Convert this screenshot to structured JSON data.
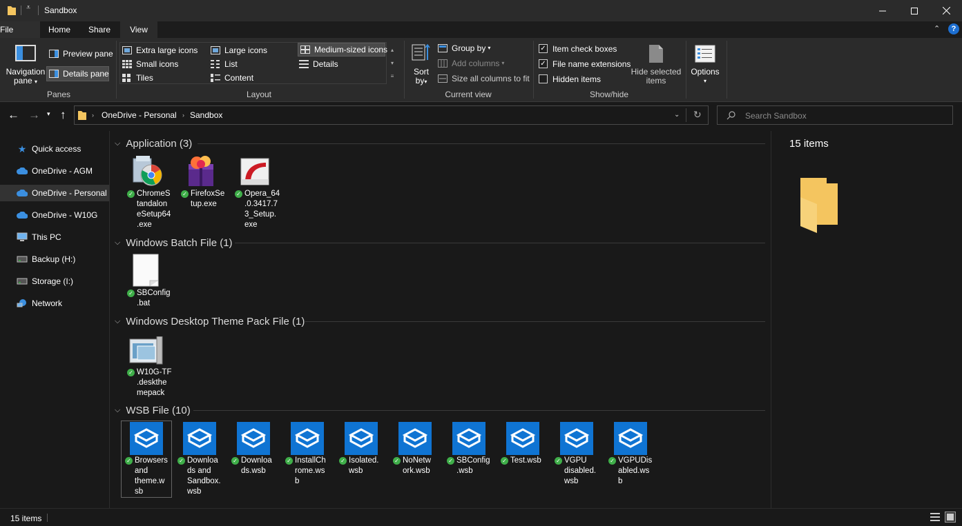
{
  "window": {
    "title": "Sandbox"
  },
  "tabs": [
    "File",
    "Home",
    "Share",
    "View"
  ],
  "ribbon": {
    "panes": {
      "navigation_pane_l1": "Navigation",
      "navigation_pane_l2": "pane",
      "preview_pane": "Preview pane",
      "details_pane": "Details pane",
      "group_label": "Panes"
    },
    "layout": {
      "items": [
        "Extra large icons",
        "Large icons",
        "Medium-sized icons",
        "Small icons",
        "List",
        "Details",
        "Tiles",
        "Content"
      ],
      "group_label": "Layout"
    },
    "current_view": {
      "sort_l1": "Sort",
      "sort_l2": "by",
      "group_by": "Group by",
      "add_columns": "Add columns",
      "size_all": "Size all columns to fit",
      "group_label": "Current view"
    },
    "show_hide": {
      "item_check_boxes": "Item check boxes",
      "file_name_extensions": "File name extensions",
      "hidden_items": "Hidden items",
      "hide_selected_l1": "Hide selected",
      "hide_selected_l2": "items",
      "group_label": "Show/hide"
    },
    "options": "Options"
  },
  "address": {
    "crumbs": [
      "OneDrive - Personal",
      "Sandbox"
    ],
    "search_placeholder": "Search Sandbox"
  },
  "sidebar": {
    "items": [
      {
        "label": "Quick access",
        "icon": "star-icon"
      },
      {
        "label": "OneDrive - AGM",
        "icon": "cloud-icon"
      },
      {
        "label": "OneDrive - Personal",
        "icon": "cloud-icon"
      },
      {
        "label": "OneDrive - W10G",
        "icon": "cloud-icon"
      },
      {
        "label": "This PC",
        "icon": "computer-icon"
      },
      {
        "label": "Backup (H:)",
        "icon": "drive-icon"
      },
      {
        "label": "Storage (I:)",
        "icon": "drive-icon"
      },
      {
        "label": "Network",
        "icon": "network-icon"
      }
    ]
  },
  "groups": [
    {
      "title": "Application (3)",
      "files": [
        {
          "name": "ChromeStandaloneSetup64.exe",
          "lines": [
            "ChromeS",
            "tandalon",
            "eSetup64",
            ".exe"
          ],
          "icon": "installer-icon"
        },
        {
          "name": "FirefoxSetup.exe",
          "lines": [
            "FirefoxSe",
            "tup.exe"
          ],
          "icon": "firefox-installer-icon"
        },
        {
          "name": "Opera_64.0.3417.73_Setup.exe",
          "lines": [
            "Opera_64",
            ".0.3417.7",
            "3_Setup.",
            "exe"
          ],
          "icon": "opera-installer-icon"
        }
      ]
    },
    {
      "title": "Windows Batch File (1)",
      "files": [
        {
          "name": "SBConfig.bat",
          "lines": [
            "SBConfig",
            ".bat"
          ],
          "icon": "batch-file-icon"
        }
      ]
    },
    {
      "title": "Windows Desktop Theme Pack File (1)",
      "files": [
        {
          "name": "W10G-TF.deskthemepack",
          "lines": [
            "W10G-TF",
            ".deskthe",
            "mepack"
          ],
          "icon": "theme-pack-icon"
        }
      ]
    },
    {
      "title": "WSB File (10)",
      "files": [
        {
          "name": "Browsers and theme.wsb",
          "lines": [
            "Browsers",
            "and",
            "theme.w",
            "sb"
          ],
          "icon": "wsb-icon"
        },
        {
          "name": "Downloads and Sandbox.wsb",
          "lines": [
            "Downloa",
            "ds and",
            "Sandbox.",
            "wsb"
          ],
          "icon": "wsb-icon"
        },
        {
          "name": "Downloads.wsb",
          "lines": [
            "Downloa",
            "ds.wsb"
          ],
          "icon": "wsb-icon"
        },
        {
          "name": "InstallChrome.wsb",
          "lines": [
            "InstallCh",
            "rome.ws",
            "b"
          ],
          "icon": "wsb-icon"
        },
        {
          "name": "Isolated.wsb",
          "lines": [
            "Isolated.",
            "wsb"
          ],
          "icon": "wsb-icon"
        },
        {
          "name": "NoNetwork.wsb",
          "lines": [
            "NoNetw",
            "ork.wsb"
          ],
          "icon": "wsb-icon"
        },
        {
          "name": "SBConfig.wsb",
          "lines": [
            "SBConfig",
            ".wsb"
          ],
          "icon": "wsb-icon"
        },
        {
          "name": "Test.wsb",
          "lines": [
            "Test.wsb"
          ],
          "icon": "wsb-icon"
        },
        {
          "name": "VGPU disabled.wsb",
          "lines": [
            "VGPU",
            "disabled.",
            "wsb"
          ],
          "icon": "wsb-icon"
        },
        {
          "name": "VGPUDisabled.wsb",
          "lines": [
            "VGPUDis",
            "abled.ws",
            "b"
          ],
          "icon": "wsb-icon"
        }
      ]
    }
  ],
  "preview": {
    "count": "15 items"
  },
  "status": {
    "count": "15 items"
  },
  "colors": {
    "accent": "#0f74d3",
    "sync_ok": "#3fae49",
    "folder": "#f4c55f"
  }
}
